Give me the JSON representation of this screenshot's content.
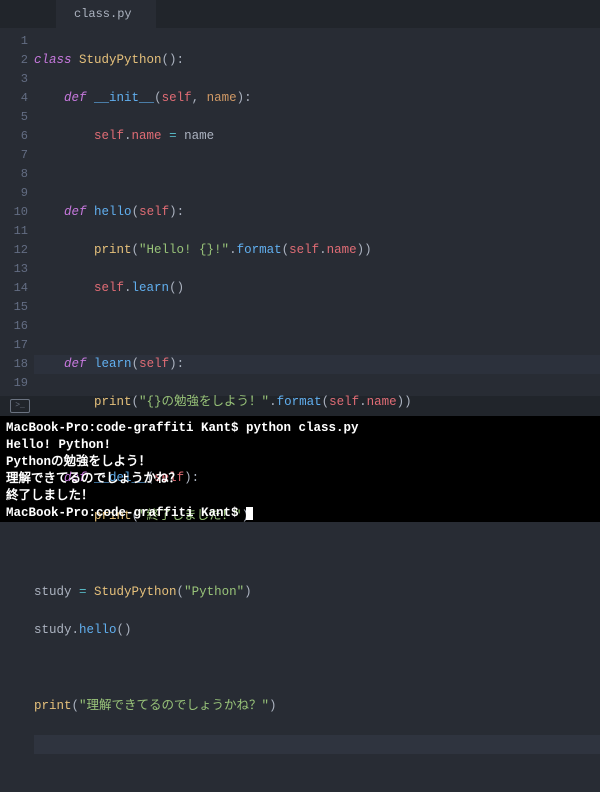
{
  "tab": {
    "filename": "class.py"
  },
  "gutter": {
    "count": 19
  },
  "code": {
    "l1": {
      "kw": "class",
      "name": "StudyPython",
      "p1": "():"
    },
    "l2": {
      "kw": "def",
      "name": "__init__",
      "p": "(",
      "self": "self",
      "c": ", ",
      "arg": "name",
      "p2": "):"
    },
    "l3": {
      "self": "self",
      "dot": ".",
      "prop": "name",
      "eq": " = ",
      "val": "name"
    },
    "l5": {
      "kw": "def",
      "name": "hello",
      "p": "(",
      "self": "self",
      "p2": "):"
    },
    "l6": {
      "fn": "print",
      "p": "(",
      "s": "\"Hello! {}!\"",
      "dot": ".",
      "m": "format",
      "p2": "(",
      "self": "self",
      "dot2": ".",
      "prop": "name",
      "p3": "))"
    },
    "l7": {
      "self": "self",
      "dot": ".",
      "m": "learn",
      "p": "()"
    },
    "l9": {
      "kw": "def",
      "name": "learn",
      "p": "(",
      "self": "self",
      "p2": "):"
    },
    "l10": {
      "fn": "print",
      "p": "(",
      "s": "\"{}の勉強をしよう！\"",
      "dot": ".",
      "m": "format",
      "p2": "(",
      "self": "self",
      "dot2": ".",
      "prop": "name",
      "p3": "))"
    },
    "l12": {
      "kw": "def",
      "name": "__del__",
      "p": "(",
      "self": "self",
      "p2": "):"
    },
    "l13": {
      "fn": "print",
      "p": "(",
      "s": "\"終了しました！\"",
      "p2": ")"
    },
    "l15": {
      "v": "study",
      "eq": " = ",
      "cls": "StudyPython",
      "p": "(",
      "s": "\"Python\"",
      "p2": ")"
    },
    "l16": {
      "v": "study",
      "dot": ".",
      "m": "hello",
      "p": "()"
    },
    "l18": {
      "fn": "print",
      "p": "(",
      "s": "\"理解できてるのでしょうかね？\"",
      "p2": ")"
    }
  },
  "terminal": {
    "lines": [
      "MacBook-Pro:code-graffiti Kant$ python class.py",
      "Hello! Python!",
      "Pythonの勉強をしよう！",
      "理解できてるのでしょうかね？",
      "終了しました！",
      "MacBook-Pro:code-graffiti Kant$ "
    ]
  }
}
